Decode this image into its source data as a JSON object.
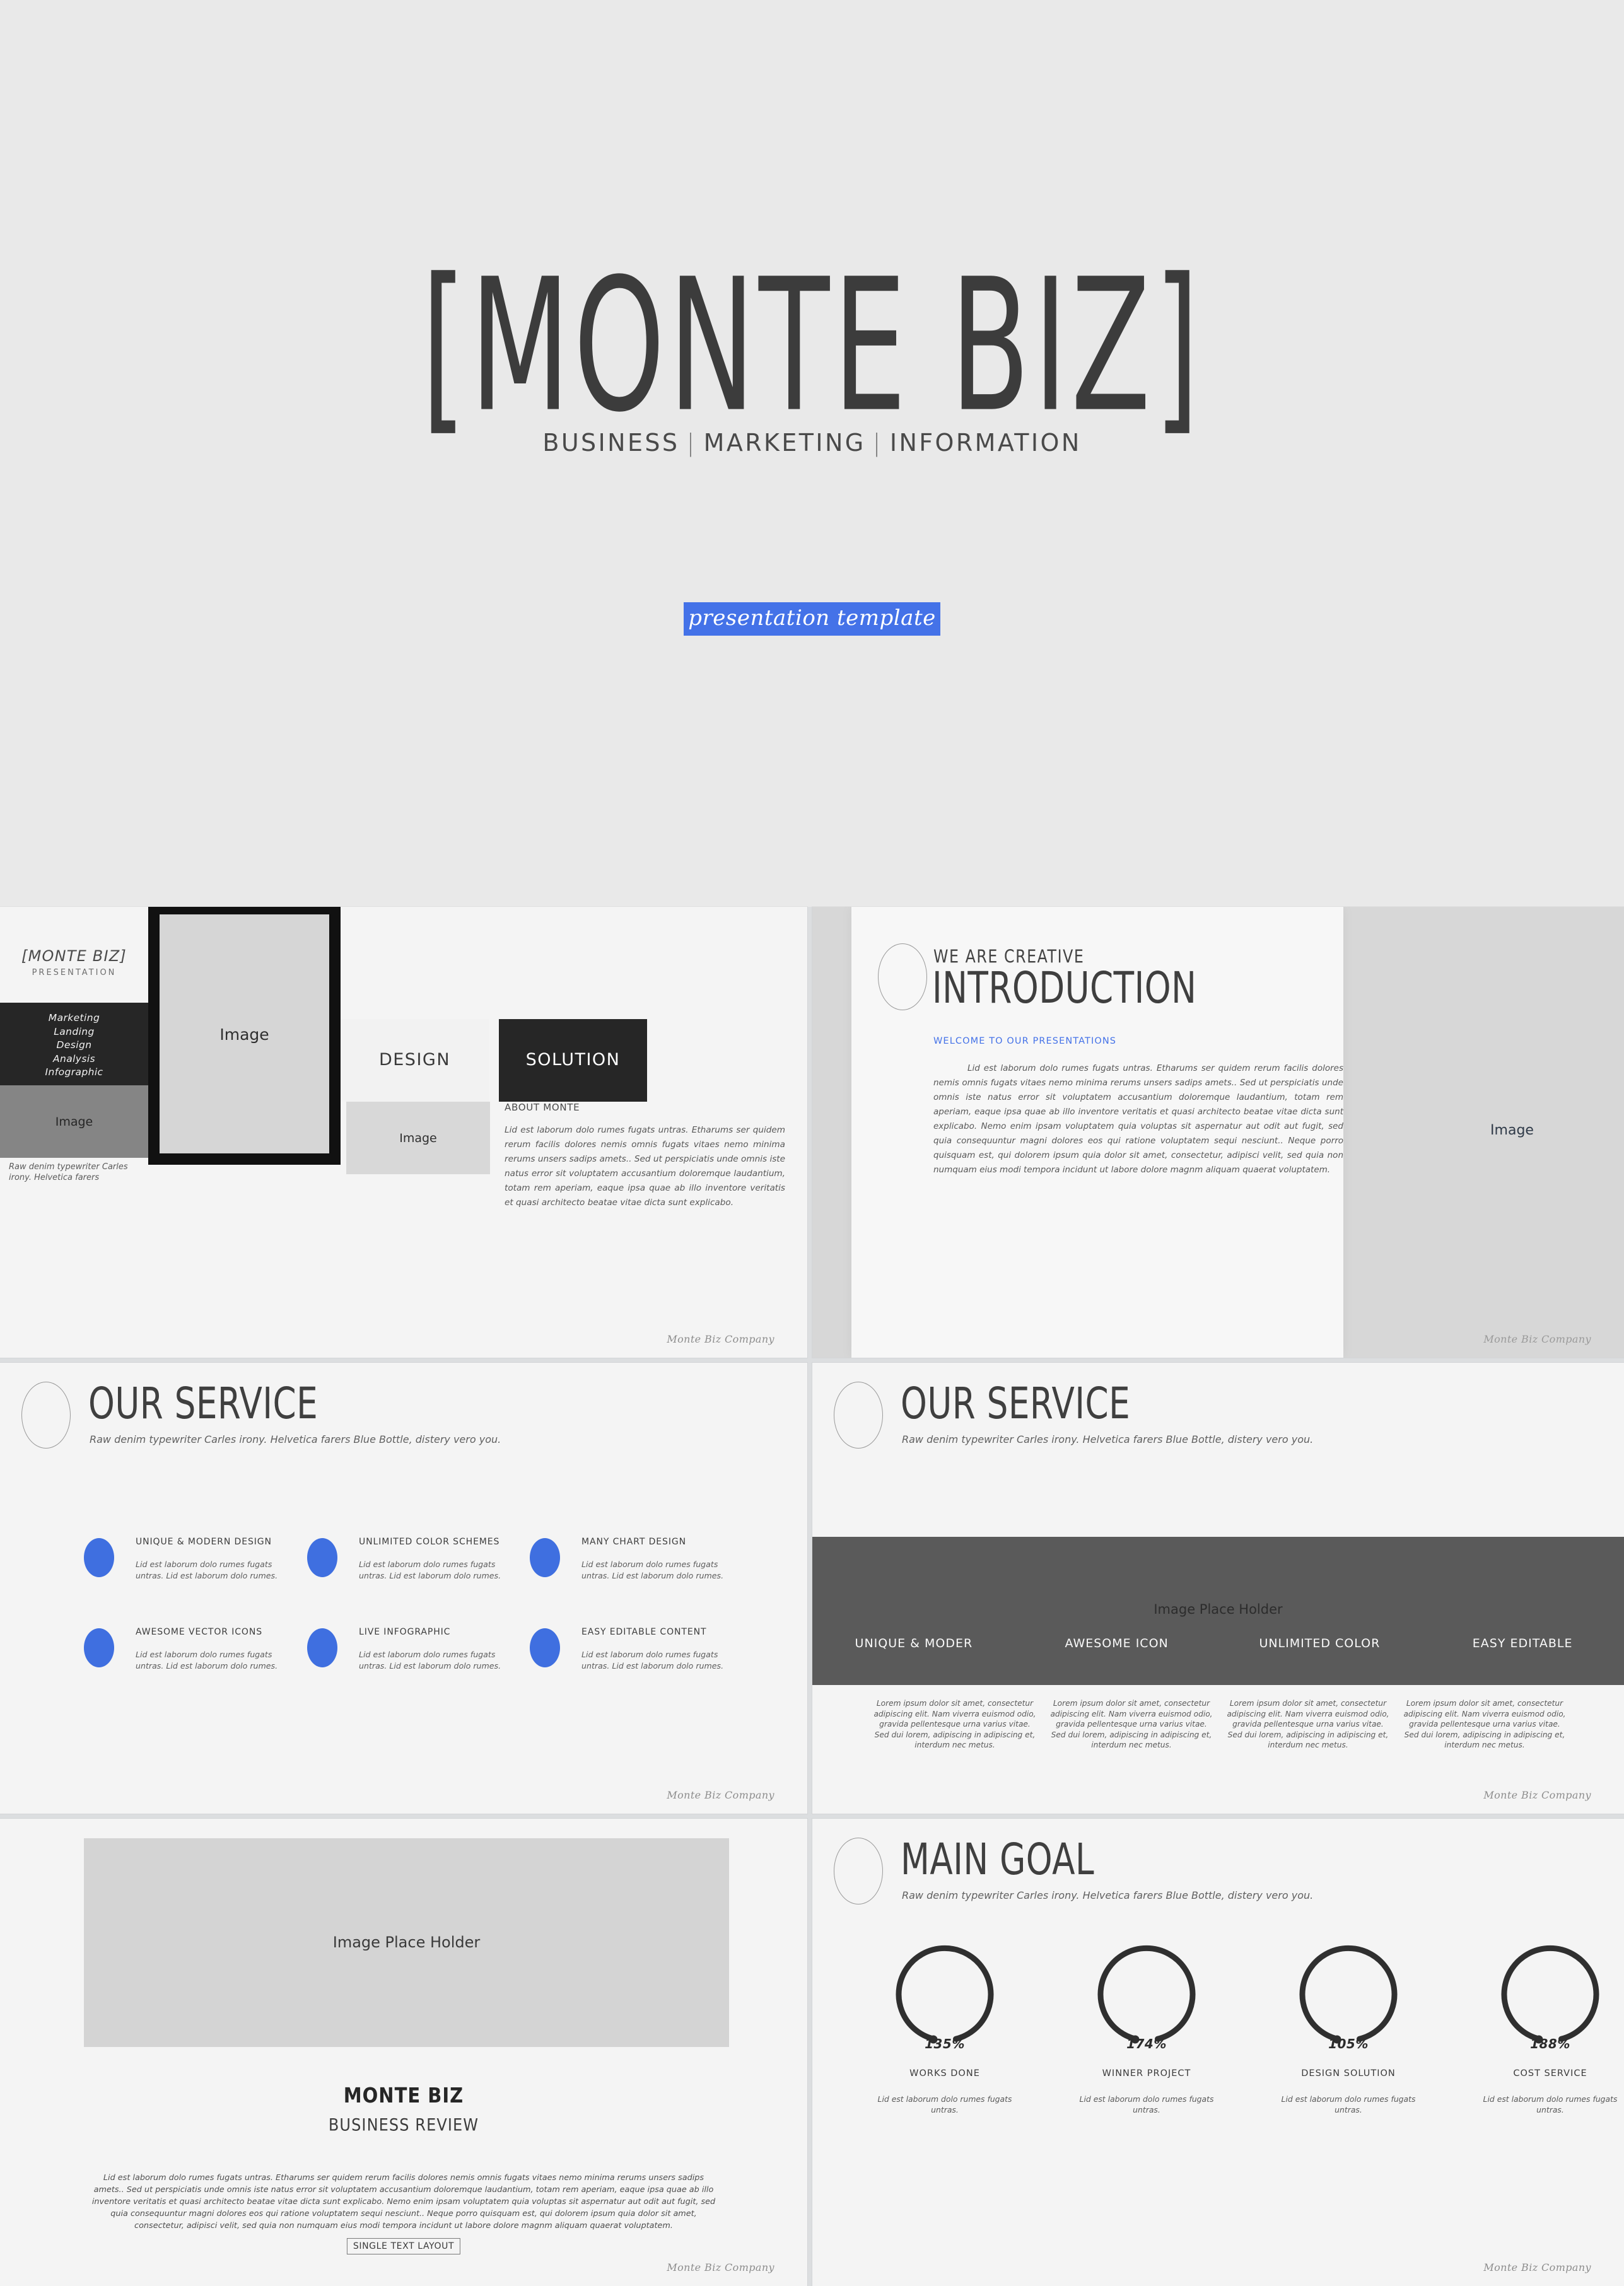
{
  "hero": {
    "title": "[MONTE BIZ]",
    "subtitle_parts": [
      "BUSINESS",
      "MARKETING",
      "INFORMATION"
    ],
    "tag": "presentation template",
    "tag_color": "#4472e8",
    "background": "#e9e9e9"
  },
  "common": {
    "footer_brand": "Monte Biz Company",
    "section_sub": "Raw denim typewriter Carles irony. Helvetica farers Blue Bottle, distery vero you.",
    "image_label": "Image",
    "image_placeholder_label": "Image Place Holder",
    "accent_blue": "#3f6fe0"
  },
  "slide_cover": {
    "title": "[MONTE BIZ]",
    "subtitle": "PRESENTATION",
    "menu": [
      "Marketing",
      "Landing",
      "Design",
      "Analysis",
      "Infographic"
    ],
    "gray_image_label": "Image",
    "note": "Raw denim typewriter Carles irony. Helvetica farers",
    "big_image_label": "Image",
    "design_label": "DESIGN",
    "solution_label": "SOLUTION",
    "second_image_label": "Image",
    "about_heading": "ABOUT MONTE",
    "about_body": "Lid est laborum dolo rumes fugats untras. Etharums ser quidem rerum facilis dolores nemis omnis fugats vitaes nemo minima rerums unsers sadips amets.. Sed ut perspiciatis unde omnis iste natus error sit voluptatem accusantium doloremque laudantium, totam rem aperiam, eaque ipsa quae ab illo inventore veritatis et quasi architecto beatae vitae dicta sunt explicabo."
  },
  "slide_intro": {
    "eyebrow": "WE ARE CREATIVE",
    "title": "INTRODUCTION",
    "welcome": "WELCOME TO OUR PRESENTATIONS",
    "body": "Lid est laborum dolo rumes fugats untras. Etharums ser quidem rerum facilis dolores nemis omnis fugats vitaes nemo minima rerums unsers sadips amets.. Sed ut perspiciatis unde omnis iste natus error sit voluptatem accusantium doloremque laudantium, totam rem aperiam, eaque ipsa quae ab illo inventore veritatis et quasi architecto beatae vitae dicta sunt explicabo. Nemo enim ipsam voluptatem quia voluptas sit aspernatur aut odit aut fugit, sed quia consequuntur magni dolores eos qui ratione voluptatem sequi nesciunt.. Neque porro quisquam est, qui dolorem ipsum quia dolor sit amet, consectetur, adipisci velit, sed quia non numquam eius modi tempora incidunt ut labore dolore magnm aliquam quaerat voluptatem.",
    "image_label": "Image",
    "welcome_color": "#4472e8"
  },
  "slide_service_icons": {
    "title": "OUR SERVICE",
    "subtitle": "Raw denim typewriter Carles irony. Helvetica farers Blue Bottle, distery vero you.",
    "items": [
      {
        "title": "UNIQUE & MODERN DESIGN",
        "body": "Lid est laborum dolo rumes fugats untras. Lid est laborum dolo rumes."
      },
      {
        "title": "UNLIMITED COLOR SCHEMES",
        "body": "Lid est laborum dolo rumes fugats untras. Lid est laborum dolo rumes."
      },
      {
        "title": "MANY CHART DESIGN",
        "body": "Lid est laborum dolo rumes fugats untras. Lid est laborum dolo rumes."
      },
      {
        "title": "AWESOME VECTOR ICONS",
        "body": "Lid est laborum dolo rumes fugats untras. Lid est laborum dolo rumes."
      },
      {
        "title": "LIVE INFOGRAPHIC",
        "body": "Lid est laborum dolo rumes fugats untras. Lid est laborum dolo rumes."
      },
      {
        "title": "EASY EDITABLE CONTENT",
        "body": "Lid est laborum dolo rumes fugats untras. Lid est laborum dolo rumes."
      }
    ]
  },
  "slide_service_band": {
    "title": "OUR SERVICE",
    "subtitle": "Raw denim typewriter Carles irony. Helvetica farers Blue Bottle, distery vero you.",
    "band_image_label": "Image Place Holder",
    "band_color": "#5a5a5a",
    "columns": [
      {
        "label": "UNIQUE & MODER",
        "body": "Lorem ipsum dolor sit amet, consectetur adipiscing elit. Nam viverra euismod odio, gravida pellentesque urna varius vitae. Sed dui lorem, adipiscing in adipiscing et, interdum nec metus."
      },
      {
        "label": "AWESOME ICON",
        "body": "Lorem ipsum dolor sit amet, consectetur adipiscing elit. Nam viverra euismod odio, gravida pellentesque urna varius vitae. Sed dui lorem, adipiscing in adipiscing et, interdum nec metus."
      },
      {
        "label": "UNLIMITED COLOR",
        "body": "Lorem ipsum dolor sit amet, consectetur adipiscing elit. Nam viverra euismod odio, gravida pellentesque urna varius vitae. Sed dui lorem, adipiscing in adipiscing et, interdum nec metus."
      },
      {
        "label": "EASY EDITABLE",
        "body": "Lorem ipsum dolor sit amet, consectetur adipiscing elit. Nam viverra euismod odio, gravida pellentesque urna varius vitae. Sed dui lorem, adipiscing in adipiscing et, interdum nec metus."
      }
    ]
  },
  "slide_review": {
    "image_label": "Image Place Holder",
    "heading": "MONTE BIZ",
    "subheading": "BUSINESS REVIEW",
    "body": "Lid est laborum dolo rumes fugats untras. Etharums ser quidem rerum facilis dolores nemis omnis fugats vitaes nemo minima rerums unsers sadips amets.. Sed ut perspiciatis unde omnis iste natus error sit voluptatem accusantium doloremque laudantium, totam rem aperiam, eaque ipsa quae ab illo inventore veritatis et quasi architecto beatae vitae dicta sunt explicabo. Nemo enim ipsam voluptatem quia voluptas sit aspernatur aut odit aut fugit, sed quia consequuntur magni dolores eos qui ratione voluptatem sequi nesciunt.. Neque porro quisquam est, qui dolorem ipsum quia dolor sit amet, consectetur, adipisci velit, sed quia non numquam eius modi tempora incidunt ut labore dolore magnm aliquam quaerat voluptatem.",
    "button": "SINGLE TEXT LAYOUT"
  },
  "slide_goal": {
    "title": "MAIN GOAL",
    "subtitle": "Raw denim typewriter Carles irony. Helvetica farers Blue Bottle, distery vero you.",
    "items": [
      {
        "percent": "135%",
        "label": "WORKS DONE",
        "desc": "Lid est laborum dolo rumes fugats untras."
      },
      {
        "percent": "174%",
        "label": "WINNER PROJECT",
        "desc": "Lid est laborum dolo rumes fugats untras."
      },
      {
        "percent": "105%",
        "label": "DESIGN SOLUTION",
        "desc": "Lid est laborum dolo rumes fugats untras."
      },
      {
        "percent": "188%",
        "label": "COST SERVICE",
        "desc": "Lid est laborum dolo rumes fugats untras."
      }
    ]
  },
  "chart_data": {
    "type": "bar",
    "title": "MAIN GOAL",
    "categories": [
      "WORKS DONE",
      "WINNER PROJECT",
      "DESIGN SOLUTION",
      "COST SERVICE"
    ],
    "values": [
      135,
      174,
      105,
      188
    ],
    "unit": "%",
    "xlabel": "",
    "ylabel": "",
    "ylim": [
      0,
      200
    ],
    "legend": "none",
    "grid": false
  }
}
